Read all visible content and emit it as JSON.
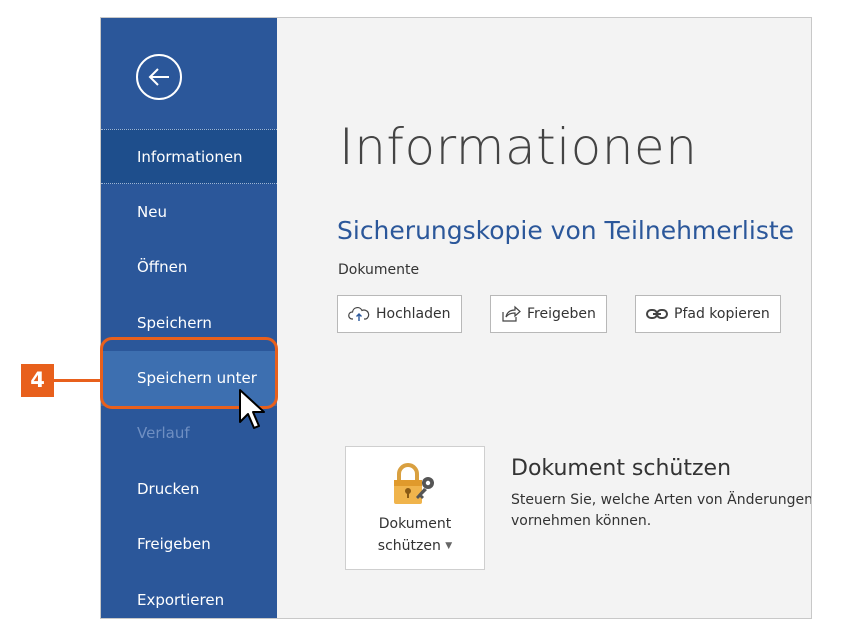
{
  "sidebar": {
    "back_icon": "back-arrow-icon",
    "items": [
      {
        "label": "Informationen",
        "state": "active"
      },
      {
        "label": "Neu",
        "state": "normal"
      },
      {
        "label": "Öffnen",
        "state": "normal"
      },
      {
        "label": "Speichern",
        "state": "normal"
      },
      {
        "label": "Speichern unter",
        "state": "hover"
      },
      {
        "label": "Verlauf",
        "state": "disabled"
      },
      {
        "label": "Drucken",
        "state": "normal"
      },
      {
        "label": "Freigeben",
        "state": "normal"
      },
      {
        "label": "Exportieren",
        "state": "normal"
      }
    ]
  },
  "main": {
    "page_title": "Informationen",
    "document_title": "Sicherungskopie von Teilnehmerliste",
    "document_location": "Dokumente",
    "actions": [
      {
        "label": "Hochladen",
        "icon": "cloud-upload-icon"
      },
      {
        "label": "Freigeben",
        "icon": "share-icon"
      },
      {
        "label": "Pfad kopieren",
        "icon": "link-icon"
      }
    ],
    "protect": {
      "tile_label_line1": "Dokument",
      "tile_label_line2": "schützen",
      "tile_icon": "lock-key-icon",
      "title": "Dokument schützen",
      "description_line1": "Steuern Sie, welche Arten von Änderungen",
      "description_line2": "vornehmen können."
    }
  },
  "annotation": {
    "step_number": "4",
    "color": "#e8601c"
  },
  "colors": {
    "sidebar": "#2b579a",
    "accent": "#2b579a",
    "callout": "#e8601c"
  }
}
